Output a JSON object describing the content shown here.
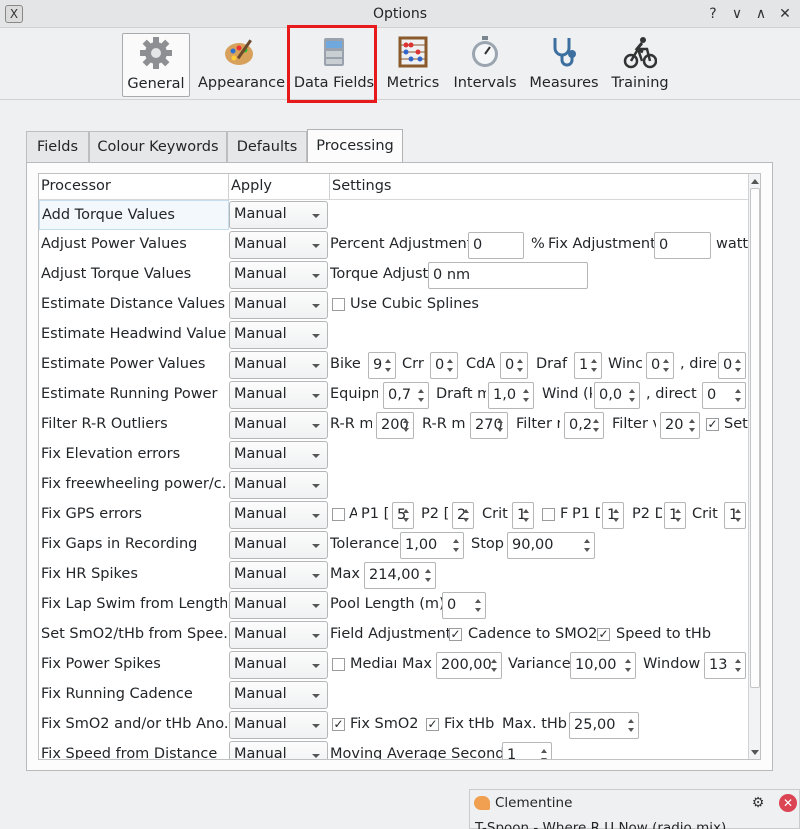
{
  "window": {
    "title": "Options",
    "app_icon": "x-icon"
  },
  "titlebar_buttons": [
    "?",
    "∨",
    "∧",
    "✕"
  ],
  "toolbar": [
    {
      "label": "General",
      "icon": "gear-icon",
      "active": true
    },
    {
      "label": "Appearance",
      "icon": "palette-icon"
    },
    {
      "label": "Data Fields",
      "icon": "cabinet-icon"
    },
    {
      "label": "Metrics",
      "icon": "abacus-icon"
    },
    {
      "label": "Intervals",
      "icon": "stopwatch-icon"
    },
    {
      "label": "Measures",
      "icon": "stethoscope-icon"
    },
    {
      "label": "Training",
      "icon": "rider-icon"
    }
  ],
  "tabs": [
    "Fields",
    "Colour Keywords",
    "Defaults",
    "Processing"
  ],
  "table": {
    "headers": [
      "Processor",
      "Apply",
      "Settings"
    ],
    "rows": [
      {
        "name": "Add Torque Values",
        "apply": "Manual"
      },
      {
        "name": "Adjust Power Values",
        "apply": "Manual"
      },
      {
        "name": "Adjust Torque Values",
        "apply": "Manual"
      },
      {
        "name": "Estimate Distance Values",
        "apply": "Manual"
      },
      {
        "name": "Estimate Headwind Values",
        "apply": "Manual"
      },
      {
        "name": "Estimate Power Values",
        "apply": "Manual"
      },
      {
        "name": "Estimate Running Power",
        "apply": "Manual"
      },
      {
        "name": "Filter R-R Outliers",
        "apply": "Manual"
      },
      {
        "name": "Fix Elevation errors",
        "apply": "Manual"
      },
      {
        "name": "Fix freewheeling power/c...",
        "apply": "Manual"
      },
      {
        "name": "Fix GPS errors",
        "apply": "Manual"
      },
      {
        "name": "Fix Gaps in Recording",
        "apply": "Manual"
      },
      {
        "name": "Fix HR Spikes",
        "apply": "Manual"
      },
      {
        "name": "Fix Lap Swim from Length...",
        "apply": "Manual"
      },
      {
        "name": "Set SmO2/tHb from Spee...",
        "apply": "Manual"
      },
      {
        "name": "Fix Power Spikes",
        "apply": "Manual"
      },
      {
        "name": "Fix Running Cadence",
        "apply": "Manual"
      },
      {
        "name": "Fix SmO2 and/or tHb Ano...",
        "apply": "Manual"
      },
      {
        "name": "Fix Speed from Distance",
        "apply": "Manual"
      }
    ]
  },
  "settings": {
    "adjust_power": {
      "percent_label": "Percent Adjustment",
      "percent_value": "0",
      "percent_unit": "%",
      "fix_label": "Fix Adjustment",
      "fix_value": "0",
      "fix_unit": "watt"
    },
    "adjust_torque": {
      "label": "Torque Adjust",
      "value": "0 nm"
    },
    "estimate_distance": {
      "label": "Use Cubic Splines"
    },
    "estimate_power": {
      "bike_label": "Bike",
      "bike_value": "9",
      "crr_label": "Crr",
      "crr_value": "0",
      "cda_label": "CdA",
      "cda_value": "0",
      "draft_label": "Draf",
      "draft_value": "1",
      "wind_label": "Winc",
      "wind_value": "0",
      "dir_label": ", dire",
      "dir_value": "0"
    },
    "estimate_running": {
      "equip_label": "Equipm",
      "equip_value": "0,7",
      "draft_label": "Draft m",
      "draft_value": "1,0",
      "wind_label": "Wind (k",
      "wind_value": "0,0",
      "dir_label": ", directi",
      "dir_value": "0"
    },
    "filter_rr": {
      "max_label": "R-R m.",
      "max_value": "200",
      "min_label": "R-R mi",
      "min_value": "270",
      "filter_label": "Filter r",
      "filter_value": "0,2",
      "filterw_label": "Filter v",
      "filterw_value": "20",
      "set_label": "Set",
      "set_mark": "✓"
    },
    "fix_gps": {
      "a_label": "A",
      "p1_label": "P1 [",
      "p1_value": "5",
      "p2_label": "P2 [",
      "p2_value": "2",
      "crit_label": "Crit",
      "crit_value": "1",
      "b_label": "F",
      "p1b_label": "P1 D",
      "p1b_value": "1",
      "p2b_label": "P2 D",
      "p2b_value": "1",
      "critb_label": "Crit",
      "critb_value": "1"
    },
    "fix_gaps": {
      "tol_label": "Tolerance",
      "tol_value": "1,00",
      "stop_label": "Stop",
      "stop_value": "90,00"
    },
    "fix_hr": {
      "max_label": "Max",
      "max_value": "214,00"
    },
    "fix_lap": {
      "label": "Pool Length (m)",
      "value": "0"
    },
    "set_smo2": {
      "field_label": "Field Adjustment",
      "cad_label": "Cadence to SMO2",
      "cad_mark": "✓",
      "speed_label": "Speed to tHb",
      "speed_mark": "✓"
    },
    "fix_power": {
      "median_label": "Mediar",
      "max_label": "Max",
      "max_value": "200,00",
      "var_label": "Variance",
      "var_value": "10,00",
      "win_label": "Window",
      "win_value": "13"
    },
    "fix_smo2": {
      "smo2_label": "Fix SmO2",
      "smo2_mark": "✓",
      "thb_label": "Fix tHb",
      "thb_mark": "✓",
      "max_label": "Max. tHb",
      "max_value": "25,00"
    },
    "fix_speed": {
      "label": "Moving Average Seconds",
      "value": "1"
    }
  },
  "notification": {
    "app": "Clementine",
    "body": "T-Spoon - Where R U Now (radio mix)"
  },
  "colors": {
    "highlight": "#e8191b",
    "close": "#da4453"
  }
}
